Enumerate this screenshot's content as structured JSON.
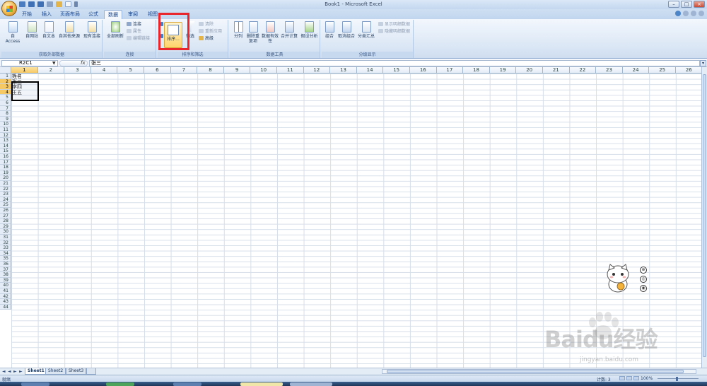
{
  "window": {
    "title": "Book1 - Microsoft Excel",
    "minimize": "–",
    "maximize": "□",
    "close": "×"
  },
  "tabs": [
    "开始",
    "插入",
    "页面布局",
    "公式",
    "数据",
    "审阅",
    "视图"
  ],
  "active_tab": "数据",
  "ribbon": {
    "external_data": {
      "title": "获取外部数据",
      "buttons": [
        "自 Access",
        "自网站",
        "自文本",
        "自其他来源",
        "现有连接"
      ]
    },
    "connections": {
      "title": "连接",
      "refresh_all": "全部刷新",
      "items": [
        "连接",
        "属性",
        "编辑链接"
      ]
    },
    "sort_filter": {
      "title": "排序和筛选",
      "sort": "排序...",
      "filter": "筛选",
      "items": [
        "清除",
        "重新应用",
        "高级"
      ]
    },
    "data_tools": {
      "title": "数据工具",
      "buttons": [
        "分列",
        "删除重复项",
        "数据有效性",
        "合并计算",
        "假设分析"
      ]
    },
    "outline": {
      "title": "分级显示",
      "buttons": [
        "组合",
        "取消组合",
        "分类汇总"
      ],
      "items": [
        "显示明细数据",
        "隐藏明细数据"
      ]
    }
  },
  "formula_bar": {
    "name_box": "R2C1",
    "fx": "fx",
    "value": "张三"
  },
  "grid": {
    "columns": [
      "1",
      "2",
      "3",
      "4",
      "5",
      "6",
      "7",
      "8",
      "9",
      "10",
      "11",
      "12",
      "13",
      "14",
      "15",
      "16",
      "17",
      "18",
      "19",
      "20",
      "21",
      "22",
      "23",
      "24",
      "25",
      "26"
    ],
    "rows": [
      "1",
      "2",
      "3",
      "4",
      "5",
      "6",
      "7",
      "8",
      "9",
      "10",
      "11",
      "12",
      "13",
      "14",
      "15",
      "16",
      "17",
      "18",
      "19",
      "20",
      "21",
      "22",
      "23",
      "24",
      "25",
      "26",
      "27",
      "28",
      "29",
      "30",
      "31",
      "32",
      "33",
      "34",
      "35",
      "36",
      "37",
      "38",
      "39",
      "40",
      "41",
      "42",
      "43",
      "44"
    ],
    "cells": [
      "姓名",
      "张三",
      "李四",
      "王五"
    ]
  },
  "sheets": [
    "Sheet1",
    "Sheet2",
    "Sheet3"
  ],
  "status": {
    "ready": "就绪",
    "count": "计数: 3",
    "zoom": "100%"
  },
  "watermark": {
    "text": "Baidu经验",
    "url": "jingyan.baidu.com"
  }
}
